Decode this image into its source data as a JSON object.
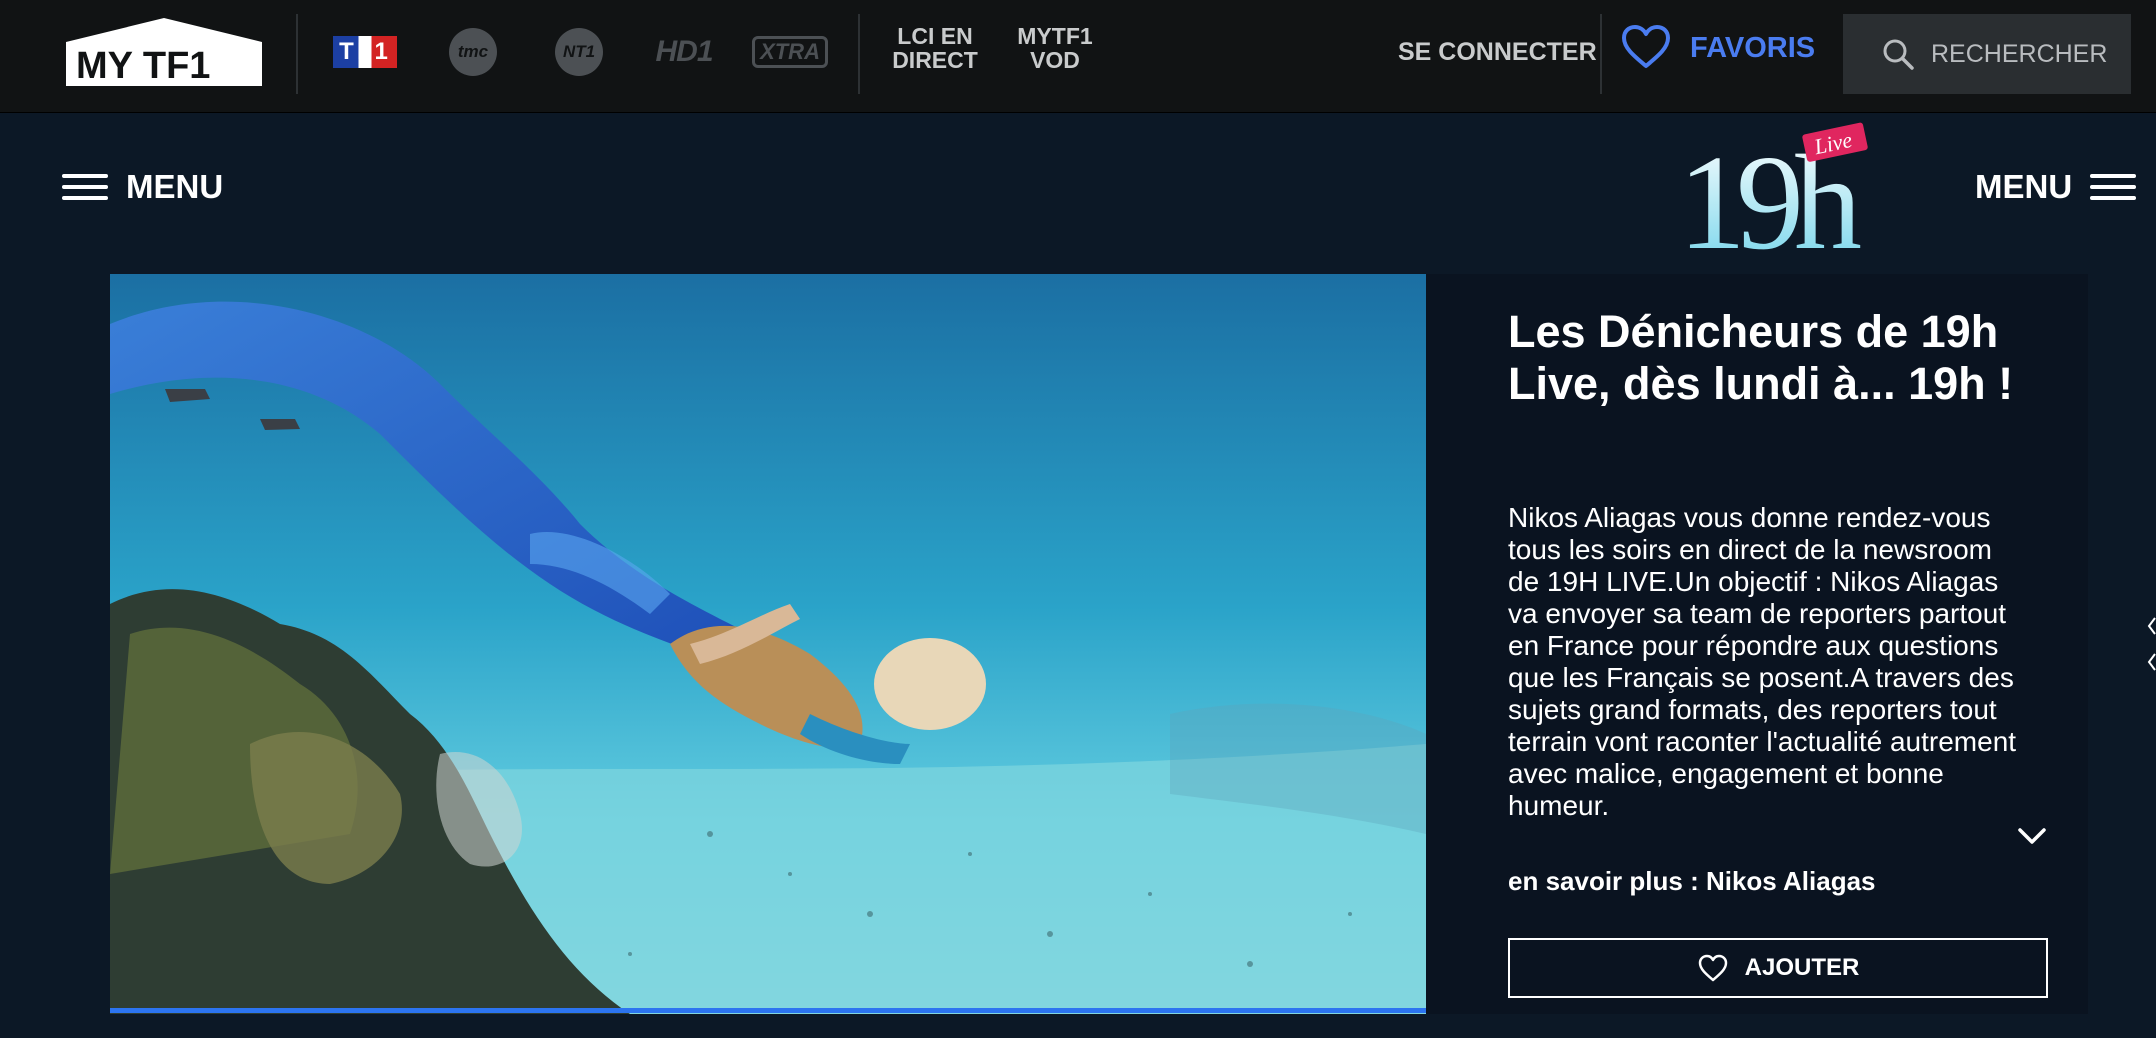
{
  "topbar": {
    "logo_text": "MY TF1",
    "channels": [
      "TF1",
      "tmc",
      "NT1",
      "HD1",
      "XTRA"
    ],
    "nav": [
      {
        "line1": "LCI EN",
        "line2": "DIRECT"
      },
      {
        "line1": "MYTF1",
        "line2": "VOD"
      }
    ],
    "login_label": "SE CONNECTER",
    "favorites_label": "FAVORIS",
    "search_label": "RECHERCHER"
  },
  "subheader": {
    "menu_left_label": "MENU",
    "menu_right_label": "MENU",
    "show_logo_text": "19h",
    "show_logo_badge": "Live"
  },
  "content": {
    "title": "Les Dénicheurs de 19h Live, dès lundi à... 19h !",
    "description": "Nikos Aliagas vous donne rendez-vous tous les soirs en direct de la newsroom de 19H LIVE.Un objectif : Nikos Aliagas va envoyer sa team de reporters partout en France pour répondre aux questions que les Français se posent.A travers des sujets grand formats, des reporters tout terrain vont raconter l'actualité autrement avec malice, engagement et bonne humeur.",
    "more_label": "en savoir plus : Nikos Aliagas",
    "add_label": "AJOUTER"
  },
  "colors": {
    "background": "#0c1826",
    "topbar": "#111314",
    "favorites_accent": "#4a7cf0",
    "progress": "#2c74f0"
  }
}
